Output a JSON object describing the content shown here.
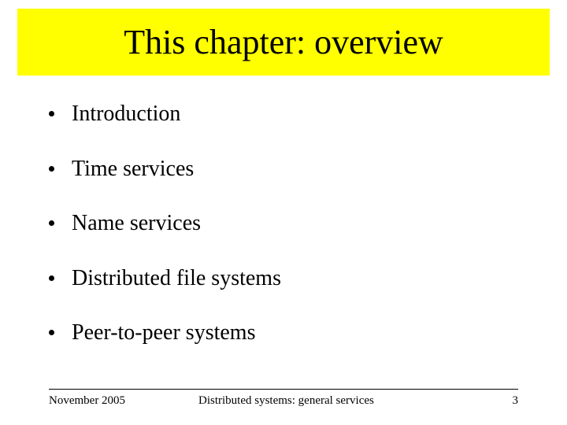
{
  "title": "This chapter: overview",
  "bullets": [
    "Introduction",
    "Time services",
    "Name services",
    "Distributed file systems",
    "Peer-to-peer systems"
  ],
  "footer": {
    "left": "November 2005",
    "center": "Distributed systems: general services",
    "right": "3"
  }
}
